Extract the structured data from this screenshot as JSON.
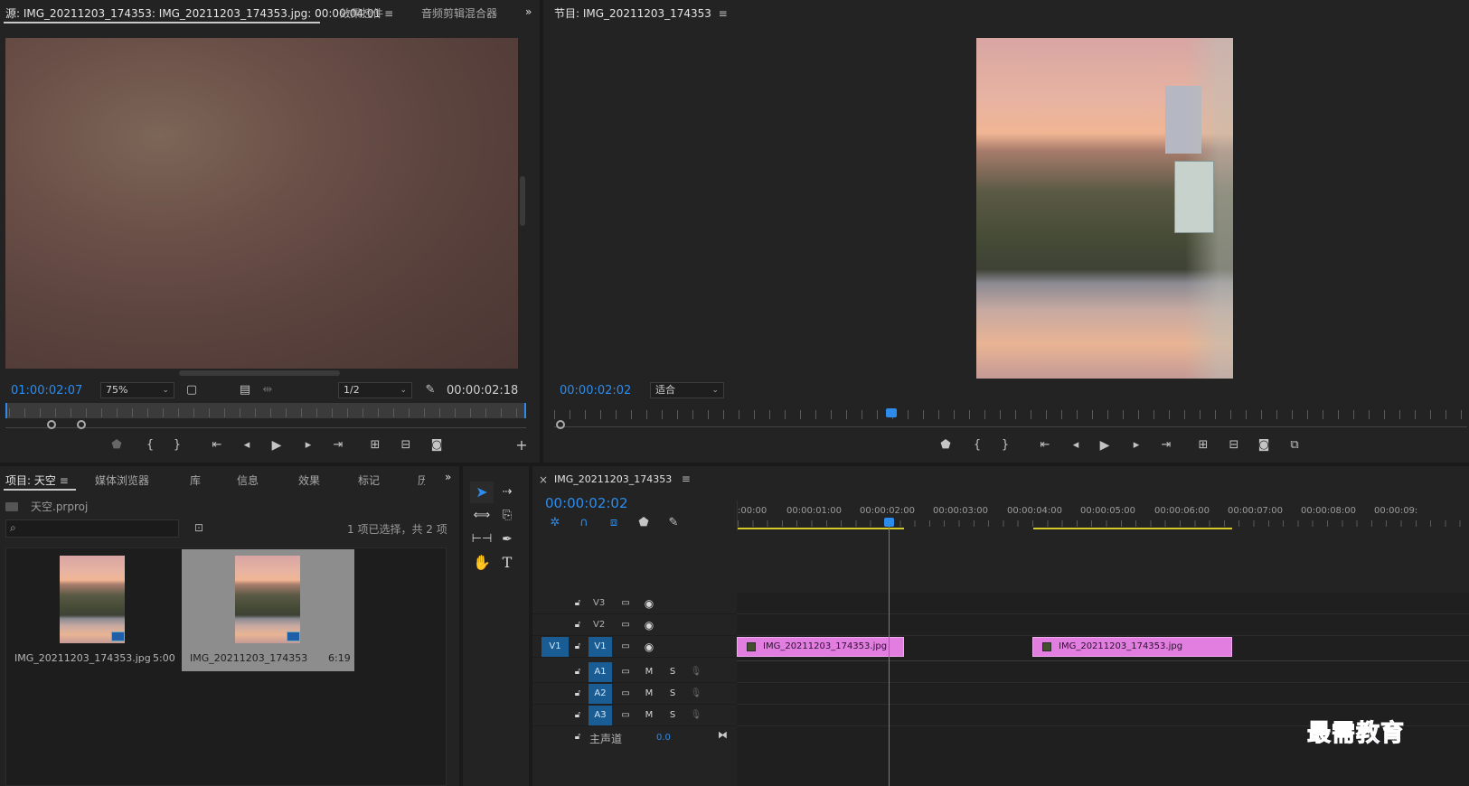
{
  "source": {
    "tab_title": "源: IMG_20211203_174353: IMG_20211203_174353.jpg: 00:00:04:01",
    "tab_effects": "效果控件",
    "tab_audio_mixer": "音频剪辑混合器",
    "timecode_in": "01:00:02:07",
    "zoom": "75%",
    "resolution": "1/2",
    "timecode_out": "00:00:02:18"
  },
  "program": {
    "tab_title": "节目: IMG_20211203_174353",
    "timecode": "00:00:02:02",
    "fit": "适合"
  },
  "project": {
    "tab_project": "项目: 天空",
    "tab_media_browser": "媒体浏览器",
    "tab_library": "库",
    "tab_info": "信息",
    "tab_effects": "效果",
    "tab_markers": "标记",
    "tab_more": "历",
    "file_name": "天空.prproj",
    "selection_status": "1 项已选择，共 2 项",
    "items": [
      {
        "name": "IMG_20211203_174353.jpg",
        "duration": "5:00",
        "selected": false
      },
      {
        "name": "IMG_20211203_174353",
        "duration": "6:19",
        "selected": true
      }
    ]
  },
  "timeline": {
    "tab_title": "IMG_20211203_174353",
    "close": "×",
    "timecode": "00:00:02:02",
    "ruler": ":00:00",
    "ruler_labels": [
      "00:00:01:00",
      "00:00:02:00",
      "00:00:03:00",
      "00:00:04:00",
      "00:00:05:00",
      "00:00:06:00",
      "00:00:07:00",
      "00:00:08:00",
      "00:00:09:"
    ],
    "tracks": {
      "v3": "V3",
      "v2": "V2",
      "v1_source": "V1",
      "v1": "V1",
      "a1": "A1",
      "a2": "A2",
      "a3": "A3",
      "m": "M",
      "s": "S",
      "master": "主声道",
      "master_value": "0.0"
    },
    "clips": [
      {
        "name": "IMG_20211203_174353.jpg"
      },
      {
        "name": "IMG_20211203_174353.jpg"
      }
    ]
  },
  "watermark": "最需教育",
  "colors": {
    "accent": "#2d8ceb",
    "clip": "#e27ee0",
    "track_target": "#1a5d95",
    "work_area": "#d4c92a"
  }
}
